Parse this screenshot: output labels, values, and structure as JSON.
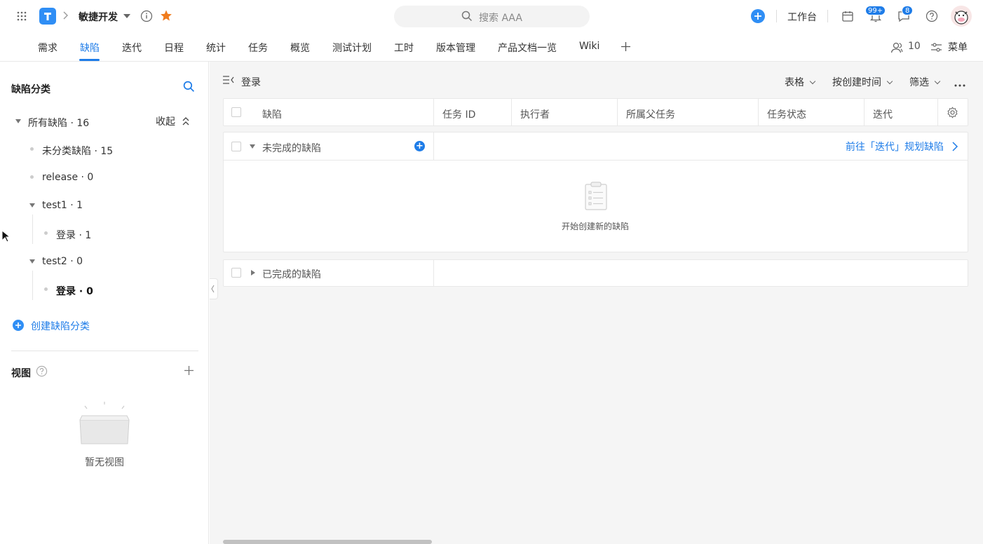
{
  "header": {
    "project_name": "敏捷开发",
    "search_placeholder": "搜索 AAA",
    "workbench_label": "工作台",
    "notif_badge": "99+",
    "msg_badge": "8",
    "member_count": "10",
    "menu_label": "菜单",
    "brand_color": "#1e7ce8",
    "star_color": "#f07b1d"
  },
  "tabs": [
    "需求",
    "缺陷",
    "迭代",
    "日程",
    "统计",
    "任务",
    "概览",
    "测试计划",
    "工时",
    "版本管理",
    "产品文档一览",
    "Wiki"
  ],
  "active_tab": "缺陷",
  "sidebar": {
    "title": "缺陷分类",
    "all_label": "所有缺陷 · 16",
    "collapse_label": "收起",
    "items": [
      {
        "label": "未分类缺陷 · 15"
      },
      {
        "label": "release · 0"
      },
      {
        "label": "test1 · 1"
      },
      {
        "label": "登录 · 1"
      },
      {
        "label": "test2 · 0"
      },
      {
        "label": "登录 · 0"
      }
    ],
    "create_label": "创建缺陷分类",
    "views_title": "视图",
    "views_empty": "暂无视图"
  },
  "main": {
    "breadcrumb": "登录",
    "view_label": "表格",
    "sort_label": "按创建时间",
    "filter_label": "筛选",
    "columns": [
      "缺陷",
      "任务 ID",
      "执行者",
      "所属父任务",
      "任务状态",
      "迭代"
    ],
    "group_incomplete": "未完成的缺陷",
    "plan_link": "前往「迭代」规划缺陷",
    "empty_text": "开始创建新的缺陷",
    "group_complete": "已完成的缺陷"
  }
}
